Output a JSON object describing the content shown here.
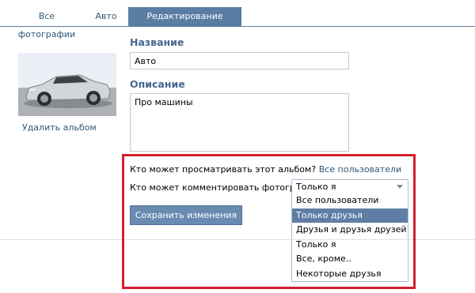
{
  "tabs": [
    {
      "label": "Все фотографии"
    },
    {
      "label": "Авто"
    },
    {
      "label": "Редактирование альбома"
    }
  ],
  "album": {
    "delete_label": "Удалить альбом"
  },
  "form": {
    "name_label": "Название",
    "name_value": "Авто",
    "description_label": "Описание",
    "description_value": "Про машины",
    "view_question": "Кто может просматривать этот альбом?",
    "view_value": "Все пользователи",
    "comment_question": "Кто может комментировать фотографии?",
    "comment_value": "Только я",
    "save_label": "Сохранить изменения"
  },
  "dropdown": {
    "options": [
      "Все пользователи",
      "Только друзья",
      "Друзья и друзья друзей",
      "Только я",
      "Все, кроме..",
      "Некоторые друзья"
    ],
    "highlighted": "Только друзья"
  },
  "colors": {
    "accent": "#597da3",
    "link": "#2b587a",
    "label": "#45688e",
    "highlight_box": "#d3202f"
  }
}
